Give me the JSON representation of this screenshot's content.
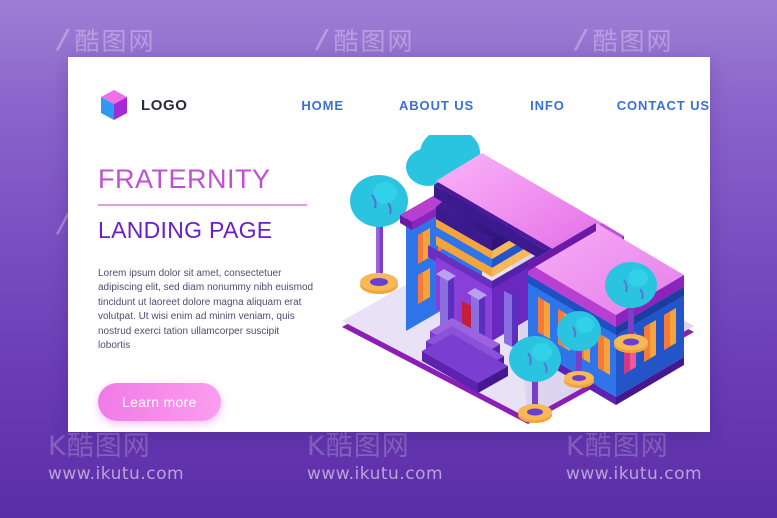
{
  "page": {
    "background_top": "#9d7fd4",
    "background_bottom": "#5b2da6",
    "card_background": "#ffffff"
  },
  "watermark": {
    "slash": "/",
    "mark_cn": "酷图网",
    "brand_mark": "K酷图网",
    "url": "www.ikutu.com",
    "repeat_count": 3
  },
  "header": {
    "logo_label": "LOGO",
    "logo_icon": "isometric-cube-icon",
    "logo_colors": {
      "top": "#ef6fe8",
      "left": "#2f9bf0",
      "right": "#a32bd6"
    },
    "nav": [
      {
        "label": "HOME"
      },
      {
        "label": "ABOUT US"
      },
      {
        "label": "INFO"
      },
      {
        "label": "CONTACT US"
      }
    ],
    "nav_color": "#3a6fd8"
  },
  "hero": {
    "title": "FRATERNITY",
    "title_color": "#c04fd4",
    "subtitle": "LANDING PAGE",
    "subtitle_color": "#6a20c8",
    "divider_color": "#e49ae8",
    "paragraph": "Lorem ipsum dolor sit amet, consectetuer adipiscing elit, sed diam nonummy nibh euismod tincidunt ut laoreet dolore magna aliquam erat volutpat. Ut wisi enim ad minim veniam, quis nostrud exerci tation ullamcorper suscipit lobortis",
    "paragraph_color": "#4d4d73",
    "cta_label": "Learn more",
    "cta_color": "#f58ae9"
  },
  "illustration": {
    "name": "isometric-fraternity-house",
    "alt": "Isometric college fraternity house with columns, portico, pink roof and cyan trees on a lavender platform",
    "palette": {
      "platform": "#e3dcf2",
      "platform_edge": "#8b1fb5",
      "roof_light": "#f49cf4",
      "roof_mid": "#e87ae8",
      "roof_dark": "#b83fd0",
      "wall_blue": "#2f74e8",
      "wall_blue_dark": "#1f4fc4",
      "window_orange": "#f5a43c",
      "window_pink": "#f05a9b",
      "outline": "#3a1a8c",
      "tree_foliage": "#2bc4e0",
      "tree_trunk": "#7a3fc8",
      "tree_base": "#f5a43c",
      "door_red": "#e8324a",
      "column": "#6a3fd0"
    },
    "tree_count": 6
  }
}
